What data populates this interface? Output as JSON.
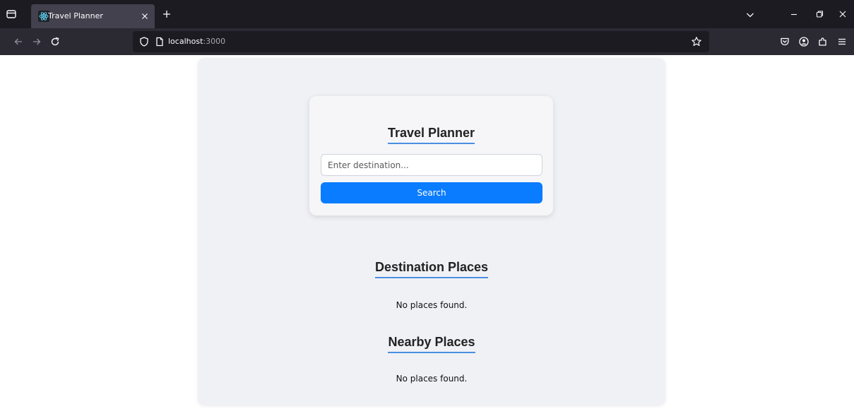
{
  "browser": {
    "tab_title": "Travel Planner",
    "url_host": "localhost",
    "url_port": ":3000",
    "icons": {
      "list_all_tabs": "tab-list-icon",
      "favicon": "react-icon",
      "tab_close": "close-icon",
      "new_tab": "plus-icon",
      "tabs_dropdown": "chevron-down-icon",
      "minimize": "minimize-icon",
      "restore": "restore-icon",
      "close_window": "close-icon",
      "back": "back-arrow-icon",
      "forward": "forward-arrow-icon",
      "reload": "reload-icon",
      "site_info": "shield-icon",
      "page": "page-icon",
      "bookmark": "star-icon",
      "pocket": "pocket-icon",
      "account": "account-icon",
      "extensions": "extensions-icon",
      "menu": "hamburger-menu-icon"
    }
  },
  "app": {
    "title": "Travel Planner",
    "search_placeholder": "Enter destination...",
    "search_value": "",
    "search_button": "Search",
    "destination_heading": "Destination Places",
    "destination_empty": "No places found.",
    "nearby_heading": "Nearby Places",
    "nearby_empty": "No places found.",
    "colors": {
      "accent": "#0a7cff",
      "underline": "#4a90e2",
      "app_background": "#f0f1f5",
      "card_background": "#f6f6f8"
    }
  }
}
